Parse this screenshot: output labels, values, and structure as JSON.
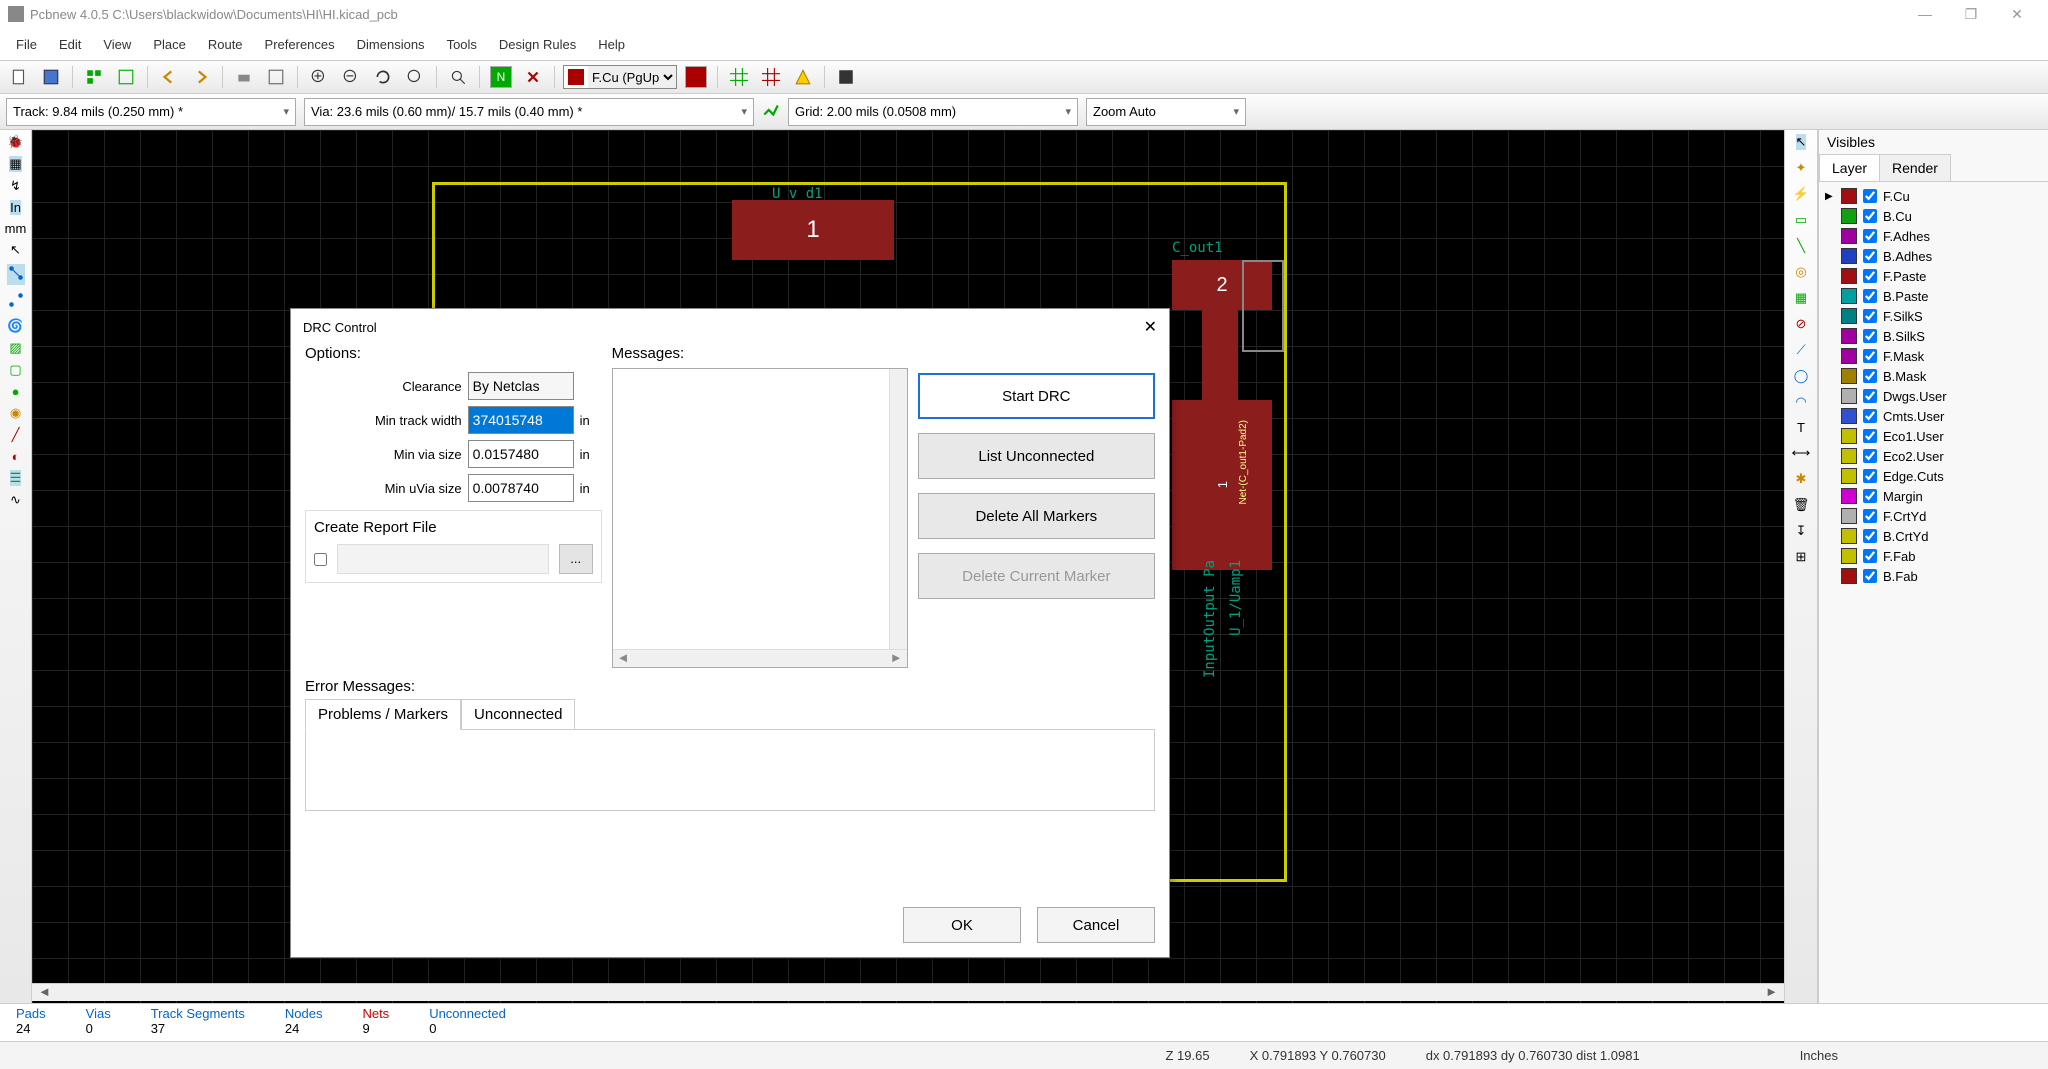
{
  "window": {
    "title": "Pcbnew 4.0.5 C:\\Users\\blackwidow\\Documents\\HI\\HI.kicad_pcb"
  },
  "menu": [
    "File",
    "Edit",
    "View",
    "Place",
    "Route",
    "Preferences",
    "Dimensions",
    "Tools",
    "Design Rules",
    "Help"
  ],
  "toolbar": {
    "layer_selected": "F.Cu (PgUp"
  },
  "second_toolbar": {
    "track": "Track: 9.84 mils (0.250 mm) *",
    "via": "Via: 23.6 mils (0.60 mm)/ 15.7 mils (0.40 mm) *",
    "grid": "Grid: 2.00 mils (0.0508 mm)",
    "zoom": "Zoom Auto"
  },
  "visibles": {
    "title": "Visibles",
    "tabs": {
      "layer": "Layer",
      "render": "Render"
    },
    "layers": [
      {
        "name": "F.Cu",
        "color": "#a01010",
        "active": true
      },
      {
        "name": "B.Cu",
        "color": "#10a010"
      },
      {
        "name": "F.Adhes",
        "color": "#a000a0"
      },
      {
        "name": "B.Adhes",
        "color": "#2040c0"
      },
      {
        "name": "F.Paste",
        "color": "#a01010"
      },
      {
        "name": "B.Paste",
        "color": "#00a0a0"
      },
      {
        "name": "F.SilkS",
        "color": "#008080"
      },
      {
        "name": "B.SilkS",
        "color": "#a000a0"
      },
      {
        "name": "F.Mask",
        "color": "#a000a0"
      },
      {
        "name": "B.Mask",
        "color": "#a08000"
      },
      {
        "name": "Dwgs.User",
        "color": "#b0b0b0"
      },
      {
        "name": "Cmts.User",
        "color": "#3050d0"
      },
      {
        "name": "Eco1.User",
        "color": "#c0c000"
      },
      {
        "name": "Eco2.User",
        "color": "#c0c000"
      },
      {
        "name": "Edge.Cuts",
        "color": "#c0c000"
      },
      {
        "name": "Margin",
        "color": "#d000d0"
      },
      {
        "name": "F.CrtYd",
        "color": "#b0b0b0"
      },
      {
        "name": "B.CrtYd",
        "color": "#c0c000"
      },
      {
        "name": "F.Fab",
        "color": "#c0c000"
      },
      {
        "name": "B.Fab",
        "color": "#a01010"
      }
    ]
  },
  "stats": {
    "pads": {
      "label": "Pads",
      "value": "24"
    },
    "vias": {
      "label": "Vias",
      "value": "0"
    },
    "segments": {
      "label": "Track Segments",
      "value": "37"
    },
    "nodes": {
      "label": "Nodes",
      "value": "24"
    },
    "nets": {
      "label": "Nets",
      "value": "9"
    },
    "unconnected": {
      "label": "Unconnected",
      "value": "0"
    }
  },
  "status": {
    "z": "Z 19.65",
    "xy": "X 0.791893  Y 0.760730",
    "dxy": "dx 0.791893  dy 0.760730  dist 1.0981",
    "units": "Inches"
  },
  "canvas": {
    "ref1": "U_v_d1",
    "ref2": "C_out1",
    "vtext1": "Net-(C_out1-Pad2)",
    "vtext2": "InputOutput Pa",
    "vtext3": "U_1/Uamp1"
  },
  "dialog": {
    "title": "DRC Control",
    "options_label": "Options:",
    "messages_label": "Messages:",
    "clearance_label": "Clearance",
    "clearance_value": "By Netclas",
    "min_track_label": "Min track width",
    "min_track_value": "374015748",
    "min_via_label": "Min via size",
    "min_via_value": "0.0157480",
    "min_uvia_label": "Min uVia size",
    "min_uvia_value": "0.0078740",
    "unit": "in",
    "create_report": "Create Report File",
    "start_drc": "Start DRC",
    "list_unconnected": "List Unconnected",
    "delete_all": "Delete All Markers",
    "delete_current": "Delete Current Marker",
    "error_messages_label": "Error Messages:",
    "tab_problems": "Problems / Markers",
    "tab_unconnected": "Unconnected",
    "ok": "OK",
    "cancel": "Cancel"
  }
}
